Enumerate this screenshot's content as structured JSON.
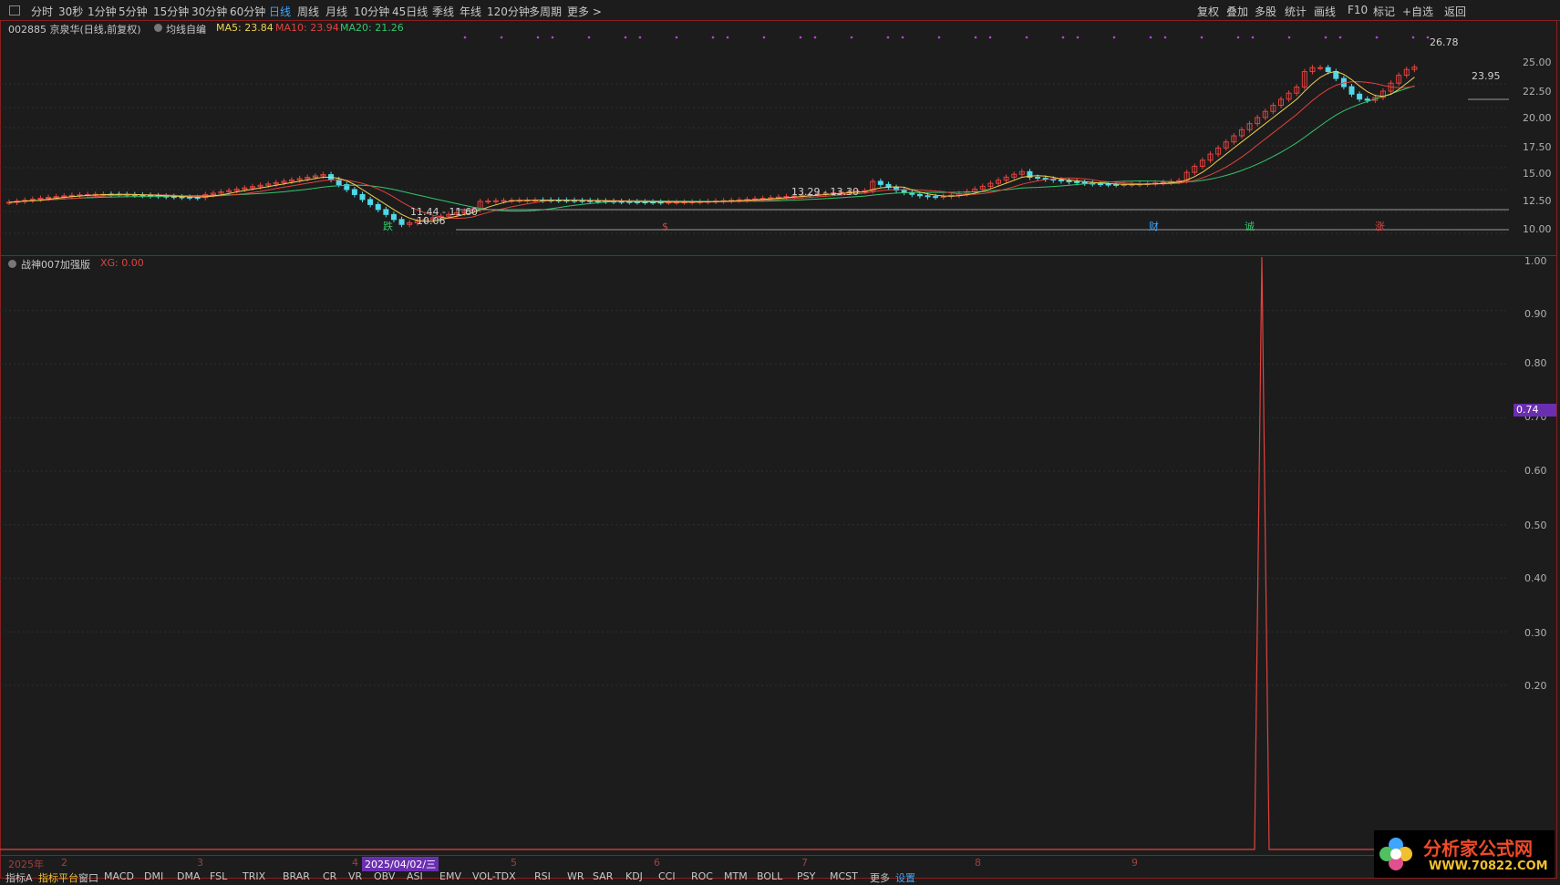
{
  "toolbar": {
    "periods": [
      "分时",
      "30秒",
      "1分钟",
      "5分钟",
      "15分钟",
      "30分钟",
      "60分钟",
      "日线",
      "周线",
      "月线",
      "10分钟",
      "45日线",
      "季线",
      "年线",
      "120分钟",
      "多周期",
      "更多 >"
    ],
    "active_period": "日线",
    "right": [
      "复权",
      "叠加",
      "多股",
      "统计",
      "画线",
      "F10",
      "标记",
      "+自选",
      "返回"
    ]
  },
  "stock": {
    "code_name": "002885 京泉华(日线,前复权)",
    "indicator": "均线自编",
    "ma5": "MA5: 23.84",
    "ma10": "MA10: 23.94",
    "ma20": "MA20: 21.26"
  },
  "price_axis": [
    "25.00",
    "22.50",
    "20.00",
    "17.50",
    "15.00",
    "12.50",
    "10.00"
  ],
  "annotations": {
    "high": "26.78",
    "last": "23.95",
    "low_range": "11.44 - 11.60",
    "low": "10.06",
    "mid_range": "13.29 - 13.30"
  },
  "event_markers": [
    {
      "label": "跌",
      "color": "#35c56b"
    },
    {
      "label": "$",
      "color": "#e0433f"
    },
    {
      "label": "财",
      "color": "#3ea6ff"
    },
    {
      "label": "诚",
      "color": "#35c56b"
    },
    {
      "label": "涨",
      "color": "#e0433f"
    }
  ],
  "sub_indicator": {
    "name": "战神007加强版",
    "xg": "XG: 0.00",
    "current_value": "0.74"
  },
  "sub_axis": [
    "1.00",
    "0.90",
    "0.80",
    "0.70",
    "0.60",
    "0.50",
    "0.40",
    "0.30",
    "0.20"
  ],
  "time_axis": {
    "labels": [
      "2025年",
      "2",
      "3",
      "4",
      "2025/04/02/三",
      "5",
      "6",
      "7",
      "8",
      "9"
    ]
  },
  "bottom_tabs": [
    "指标A",
    "指标平台",
    "窗口",
    "MACD",
    "DMI",
    "DMA",
    "FSL",
    "TRIX",
    "BRAR",
    "CR",
    "VR",
    "OBV",
    "ASI",
    "EMV",
    "VOL-TDX",
    "RSI",
    "WR",
    "SAR",
    "KDJ",
    "CCI",
    "ROC",
    "MTM",
    "BOLL",
    "PSY",
    "MCST",
    "更多",
    "设置"
  ],
  "watermark": {
    "title": "分析家公式网",
    "url": "WWW.70822.COM"
  },
  "chart_data": {
    "type": "line",
    "title": "",
    "series": [
      {
        "name": "MA5",
        "color": "#f0d050"
      },
      {
        "name": "MA10",
        "color": "#e0433f"
      },
      {
        "name": "MA20",
        "color": "#35c56b"
      }
    ],
    "price_range": [
      10.0,
      26.78
    ],
    "sub_signal": {
      "name": "XG",
      "ylim": [
        0.2,
        1.0
      ],
      "spike_value": 1.0,
      "current": 0.74
    }
  }
}
